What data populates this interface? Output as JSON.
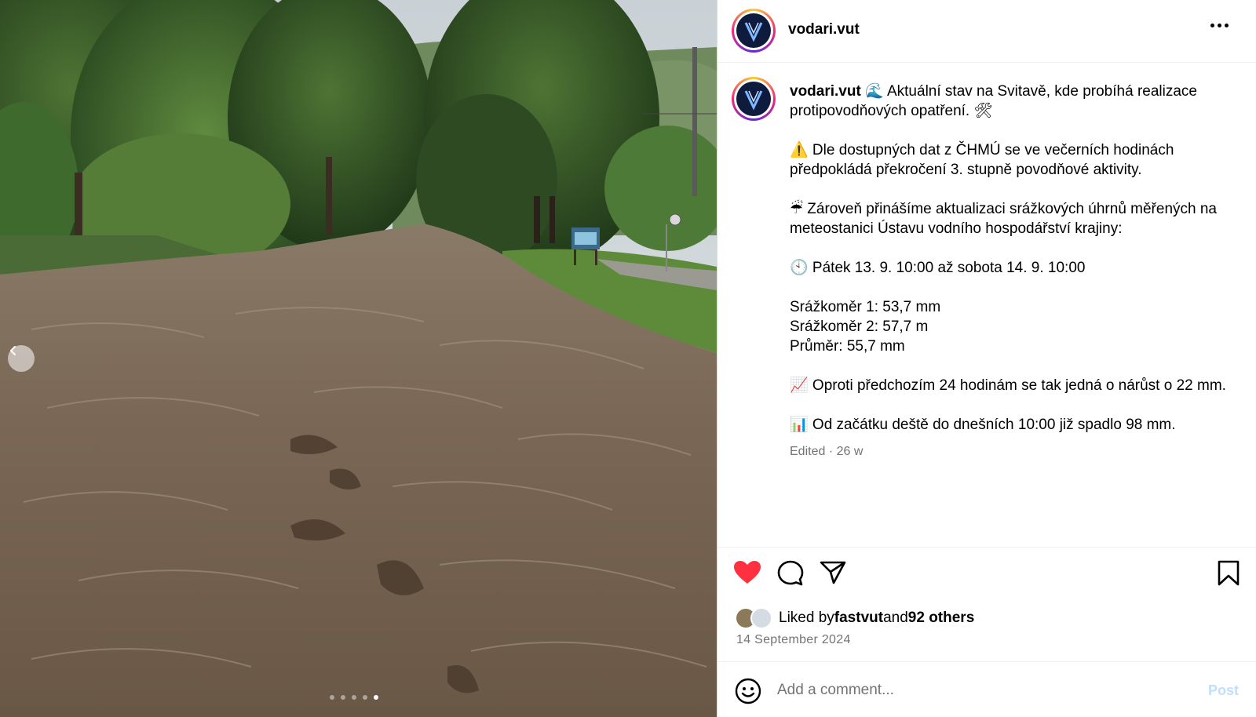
{
  "post": {
    "username": "vodari.vut",
    "more_icon": "more-horizontal-icon"
  },
  "caption": {
    "username": "vodari.vut",
    "line1": " 🌊 Aktuální stav na Svitavě, kde probíhá realizace protipovodňových opatření. 🛠",
    "line2": "⚠️ Dle dostupných dat z ČHMÚ se ve večerních hodinách předpokládá překročení 3. stupně povodňové aktivity.",
    "line3": "☔ Zároveň přinášíme aktualizaci srážkových úhrnů měřených na meteostanici Ústavu vodního hospodářství krajiny:",
    "line4": "🕙 Pátek 13. 9. 10:00 až sobota 14. 9. 10:00",
    "gauge1": "Srážkoměr 1: 53,7 mm",
    "gauge2": "Srážkoměr 2: 57,7 m",
    "average": "Průměr: 55,7 mm",
    "line5": "📈 Oproti předchozím 24 hodinám se tak jedná o nárůst o 22 mm.",
    "line6": "📊 Od začátku deště do dnešních 10:00 již spadlo 98 mm.",
    "meta": "Edited · 26 w"
  },
  "actions": {
    "liked_by_prefix": "Liked by ",
    "liked_by_user": "fastvut",
    "liked_by_and": " and ",
    "liked_by_others": "92 others",
    "date": "14 September 2024"
  },
  "comment": {
    "placeholder": "Add a comment...",
    "post_label": "Post"
  },
  "carousel": {
    "total": 5,
    "active": 4
  },
  "colors": {
    "heart": "#ff3040",
    "post_disabled": "#c0dffd",
    "muted": "#737373"
  }
}
